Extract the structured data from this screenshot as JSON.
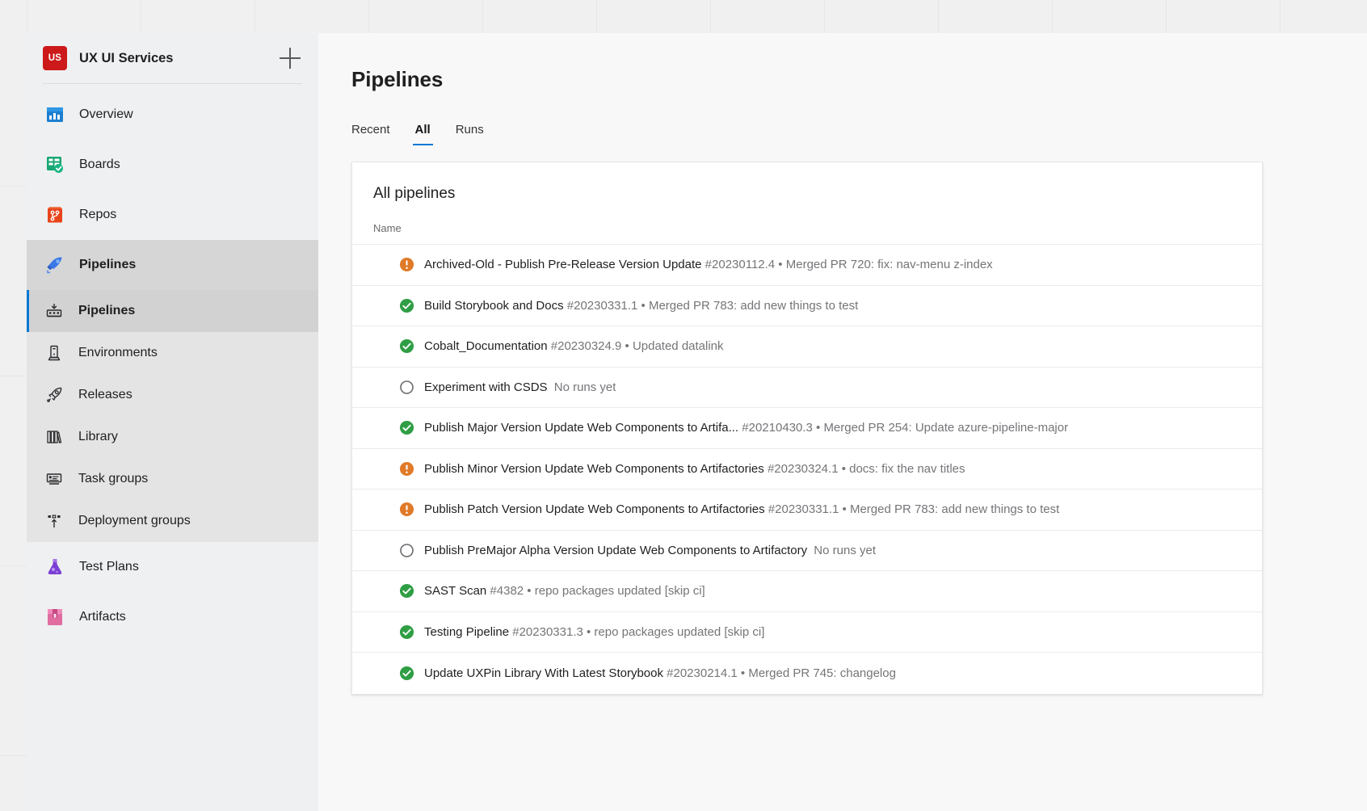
{
  "sidebar": {
    "project": {
      "avatar_initials": "US",
      "name": "UX UI Services",
      "add_button_label": "+"
    },
    "items": [
      {
        "label": "Overview",
        "icon": "overview-icon",
        "selected": false
      },
      {
        "label": "Boards",
        "icon": "boards-icon",
        "selected": false
      },
      {
        "label": "Repos",
        "icon": "repos-icon",
        "selected": false
      },
      {
        "label": "Pipelines",
        "icon": "pipelines-icon",
        "selected": true
      },
      {
        "label": "Test Plans",
        "icon": "test-plans-icon",
        "selected": false
      },
      {
        "label": "Artifacts",
        "icon": "artifacts-icon",
        "selected": false
      }
    ],
    "sub_items": [
      {
        "label": "Pipelines",
        "icon": "pipelines-sub-icon",
        "selected": true
      },
      {
        "label": "Environments",
        "icon": "environments-icon",
        "selected": false
      },
      {
        "label": "Releases",
        "icon": "releases-rocket-icon",
        "selected": false
      },
      {
        "label": "Library",
        "icon": "library-books-icon",
        "selected": false
      },
      {
        "label": "Task groups",
        "icon": "task-groups-icon",
        "selected": false
      },
      {
        "label": "Deployment groups",
        "icon": "deployment-groups-icon",
        "selected": false
      }
    ]
  },
  "main": {
    "title": "Pipelines",
    "tabs": [
      {
        "label": "Recent",
        "active": false
      },
      {
        "label": "All",
        "active": true
      },
      {
        "label": "Runs",
        "active": false
      }
    ],
    "card": {
      "title": "All pipelines",
      "column_header": "Name",
      "rows": [
        {
          "status": "warning",
          "name": "Archived-Old - Publish Pre-Release Version Update",
          "meta": "#20230112.4 • Merged PR 720: fix: nav-menu z-index"
        },
        {
          "status": "success",
          "name": "Build Storybook and Docs",
          "meta": "#20230331.1 • Merged PR 783: add new things to test"
        },
        {
          "status": "success",
          "name": "Cobalt_Documentation",
          "meta": "#20230324.9 • Updated datalink"
        },
        {
          "status": "none",
          "name": "Experiment with CSDS",
          "meta": "No runs yet"
        },
        {
          "status": "success",
          "name": "Publish Major Version Update Web Components to Artifa...",
          "meta": "#20210430.3 • Merged PR 254: Update azure-pipeline-major"
        },
        {
          "status": "warning",
          "name": "Publish Minor Version Update Web Components to Artifactories",
          "meta": "#20230324.1 • docs: fix the nav titles"
        },
        {
          "status": "warning",
          "name": "Publish Patch Version Update Web Components to Artifactories",
          "meta": "#20230331.1 • Merged PR 783: add new things to test"
        },
        {
          "status": "none",
          "name": "Publish PreMajor Alpha Version Update Web Components to Artifactory",
          "meta": "No runs yet"
        },
        {
          "status": "success",
          "name": "SAST Scan",
          "meta": "#4382 • repo packages updated [skip ci]"
        },
        {
          "status": "success",
          "name": "Testing Pipeline",
          "meta": "#20230331.3 • repo packages updated [skip ci]"
        },
        {
          "status": "success",
          "name": "Update UXPin Library With Latest Storybook",
          "meta": "#20230214.1 • Merged PR 745: changelog"
        }
      ]
    }
  },
  "colors": {
    "accent": "#0078d4",
    "avatar_red": "#cc1919",
    "status_success": "#2f9e44",
    "status_warning": "#e07a28",
    "status_none": "#6b6b70",
    "sidebar_bg": "#eff0f1",
    "subnav_bg": "#e4e4e5",
    "selected_bg": "#d6d6d7",
    "canvas_bg": "#f0f0f0"
  }
}
